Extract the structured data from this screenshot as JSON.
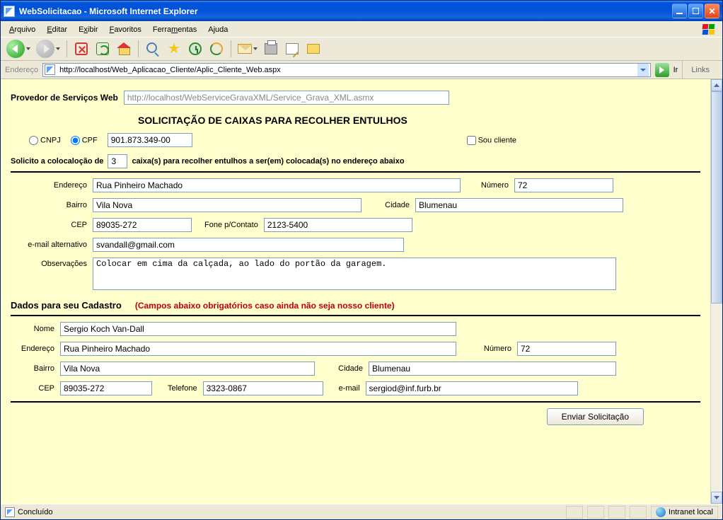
{
  "window": {
    "title": "WebSolicitacao - Microsoft Internet Explorer"
  },
  "menu": {
    "arquivo": "Arquivo",
    "editar": "Editar",
    "exibir": "Exibir",
    "favoritos": "Favoritos",
    "ferramentas": "Ferramentas",
    "ajuda": "Ajuda"
  },
  "addressbar": {
    "label": "Endereço",
    "url": "http://localhost/Web_Aplicacao_Cliente/Aplic_Cliente_Web.aspx",
    "go": "Ir",
    "links": "Links"
  },
  "page": {
    "provider_label": "Provedor de Serviços Web",
    "provider_url": "http://localhost/WebServiceGravaXML/Service_Grava_XML.asmx",
    "title": "SOLICITAÇÃO DE CAIXAS PARA RECOLHER ENTULHOS",
    "doc": {
      "cnpj_label": "CNPJ",
      "cpf_label": "CPF",
      "value": "901.873.349-00",
      "client_label": "Sou cliente"
    },
    "request": {
      "prefix": "Solicito a colocaloção de",
      "count": "3",
      "suffix": "caixa(s) para recolher entulhos a ser(em) colocada(s) no endereço abaixo"
    },
    "delivery": {
      "address_label": "Endereço",
      "address": "Rua Pinheiro Machado",
      "number_label": "Número",
      "number": "72",
      "district_label": "Bairro",
      "district": "Vila Nova",
      "city_label": "Cidade",
      "city": "Blumenau",
      "cep_label": "CEP",
      "cep": "89035-272",
      "phone_label": "Fone p/Contato",
      "phone": "2123-5400",
      "alt_email_label": "e-mail alternativo",
      "alt_email": "svandall@gmail.com",
      "notes_label": "Observações",
      "notes": "Colocar em cima da calçada, ao lado do portão da garagem."
    },
    "register": {
      "heading": "Dados para seu Cadastro",
      "warning": "(Campos abaixo obrigatórios caso ainda não seja nosso cliente)",
      "name_label": "Nome",
      "name": "Sergio Koch Van-Dall",
      "address_label": "Endereço",
      "address": "Rua Pinheiro Machado",
      "number_label": "Número",
      "number": "72",
      "district_label": "Bairro",
      "district": "Vila Nova",
      "city_label": "Cidade",
      "city": "Blumenau",
      "cep_label": "CEP",
      "cep": "89035-272",
      "phone_label": "Telefone",
      "phone": "3323-0867",
      "email_label": "e-mail",
      "email": "sergiod@inf.furb.br"
    },
    "submit": "Enviar Solicitação"
  },
  "status": {
    "left": "Concluído",
    "zone": "Intranet local"
  }
}
